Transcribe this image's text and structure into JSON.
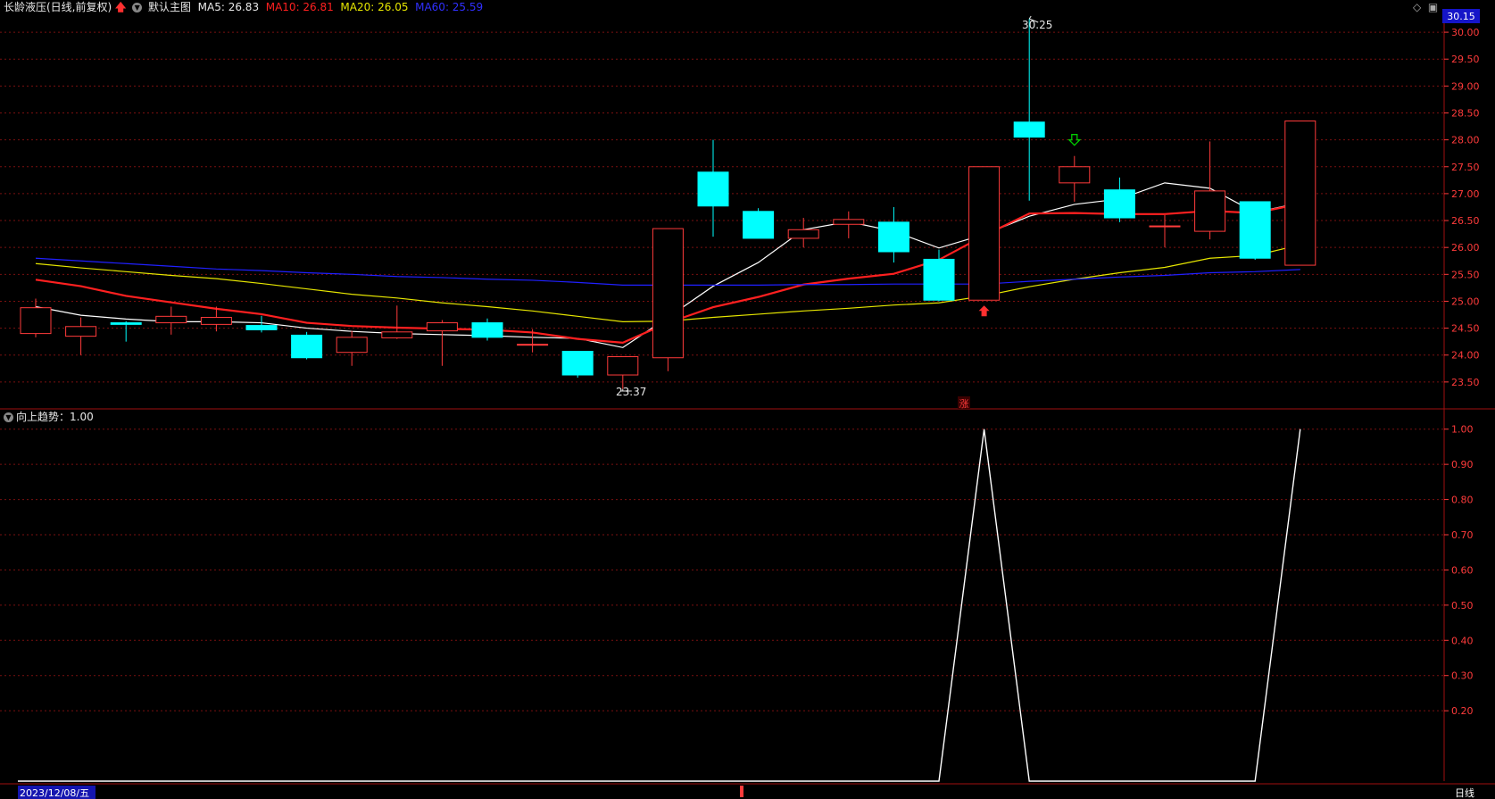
{
  "header": {
    "stock_name": "长龄液压(日线,前复权)",
    "template_label": "默认主图",
    "ma5_label": "MA5: 26.83",
    "ma10_label": "MA10: 26.81",
    "ma20_label": "MA20: 26.05",
    "ma60_label": "MA60: 25.59",
    "current_price": "30.15"
  },
  "subpanel": {
    "label": "向上趋势：1.00"
  },
  "footer": {
    "date_label": "2023/12/08/五",
    "period_label": "日线"
  },
  "annotations": {
    "high_label": "30.25",
    "low_label": "23.37",
    "zhang_marker": "涨"
  },
  "colors": {
    "up": "#ff3b3b",
    "down": "#00ffff",
    "ma5": "#ffffff",
    "ma10": "#ff2020",
    "ma20": "#e6e600",
    "ma60": "#2020ff",
    "grid": "#7a1010",
    "indicator": "#ffffff"
  },
  "chart_data": [
    {
      "type": "candlestick",
      "ylim": [
        23.0,
        30.3
      ],
      "y_ticks": [
        23.5,
        24.0,
        24.5,
        25.0,
        25.5,
        26.0,
        26.5,
        27.0,
        27.5,
        28.0,
        28.5,
        29.0,
        29.5,
        30.0
      ],
      "candles": [
        {
          "o": 24.4,
          "c": 24.88,
          "h": 25.05,
          "l": 24.33
        },
        {
          "o": 24.35,
          "c": 24.53,
          "h": 24.7,
          "l": 24.0
        },
        {
          "o": 24.6,
          "c": 24.57,
          "h": 24.63,
          "l": 24.25
        },
        {
          "o": 24.6,
          "c": 24.72,
          "h": 24.9,
          "l": 24.38
        },
        {
          "o": 24.57,
          "c": 24.7,
          "h": 24.9,
          "l": 24.44
        },
        {
          "o": 24.55,
          "c": 24.47,
          "h": 24.73,
          "l": 24.42
        },
        {
          "o": 24.37,
          "c": 23.95,
          "h": 24.43,
          "l": 23.92
        },
        {
          "o": 24.05,
          "c": 24.33,
          "h": 24.45,
          "l": 23.8
        },
        {
          "o": 24.32,
          "c": 24.43,
          "h": 24.92,
          "l": 24.3
        },
        {
          "o": 24.45,
          "c": 24.6,
          "h": 24.65,
          "l": 23.8
        },
        {
          "o": 24.6,
          "c": 24.33,
          "h": 24.68,
          "l": 24.27
        },
        {
          "o": 24.2,
          "c": 24.2,
          "h": 24.48,
          "l": 24.05
        },
        {
          "o": 24.07,
          "c": 23.63,
          "h": 24.07,
          "l": 23.58
        },
        {
          "o": 23.63,
          "c": 23.97,
          "h": 23.97,
          "l": 23.37
        },
        {
          "o": 23.95,
          "c": 26.35,
          "h": 26.35,
          "l": 23.7
        },
        {
          "o": 27.4,
          "c": 26.77,
          "h": 28.0,
          "l": 26.2
        },
        {
          "o": 26.67,
          "c": 26.17,
          "h": 26.73,
          "l": 26.17
        },
        {
          "o": 26.17,
          "c": 26.33,
          "h": 26.55,
          "l": 26.0
        },
        {
          "o": 26.43,
          "c": 26.52,
          "h": 26.67,
          "l": 26.17
        },
        {
          "o": 26.47,
          "c": 25.92,
          "h": 26.75,
          "l": 25.72
        },
        {
          "o": 25.78,
          "c": 25.02,
          "h": 25.96,
          "l": 25.0
        },
        {
          "o": 25.02,
          "c": 27.5,
          "h": 27.5,
          "l": 25.02
        },
        {
          "o": 28.33,
          "c": 28.05,
          "h": 30.25,
          "l": 26.87
        },
        {
          "o": 27.2,
          "c": 27.5,
          "h": 27.7,
          "l": 26.85
        },
        {
          "o": 27.07,
          "c": 26.55,
          "h": 27.3,
          "l": 26.47
        },
        {
          "o": 26.4,
          "c": 26.4,
          "h": 26.6,
          "l": 26.0
        },
        {
          "o": 26.3,
          "c": 27.05,
          "h": 27.97,
          "l": 26.15
        },
        {
          "o": 26.85,
          "c": 25.8,
          "h": 26.85,
          "l": 25.77
        },
        {
          "o": 25.67,
          "c": 28.35,
          "h": 28.35,
          "l": 25.67
        }
      ],
      "series": [
        {
          "name": "MA5",
          "values": [
            24.9,
            24.74,
            24.67,
            24.62,
            24.62,
            24.6,
            24.5,
            24.44,
            24.4,
            24.38,
            24.36,
            24.33,
            24.31,
            24.14,
            24.7,
            25.28,
            25.72,
            26.33,
            26.48,
            26.3,
            25.99,
            26.24,
            26.58,
            26.8,
            26.9,
            27.2,
            27.1,
            26.65,
            26.83
          ]
        },
        {
          "name": "MA10",
          "values": [
            25.4,
            25.28,
            25.1,
            24.98,
            24.86,
            24.76,
            24.6,
            24.54,
            24.51,
            24.49,
            24.47,
            24.42,
            24.3,
            24.23,
            24.6,
            24.89,
            25.08,
            25.31,
            25.42,
            25.51,
            25.77,
            26.22,
            26.63,
            26.64,
            26.62,
            26.62,
            26.68,
            26.64,
            26.81
          ]
        },
        {
          "name": "MA20",
          "values": [
            25.7,
            25.62,
            25.55,
            25.48,
            25.42,
            25.33,
            25.23,
            25.13,
            25.06,
            24.97,
            24.9,
            24.82,
            24.72,
            24.62,
            24.63,
            24.7,
            24.76,
            24.82,
            24.87,
            24.93,
            24.97,
            25.1,
            25.27,
            25.41,
            25.53,
            25.63,
            25.8,
            25.85,
            26.05
          ]
        },
        {
          "name": "MA60",
          "values": [
            25.8,
            25.75,
            25.7,
            25.65,
            25.6,
            25.57,
            25.53,
            25.5,
            25.46,
            25.44,
            25.41,
            25.39,
            25.35,
            25.3,
            25.3,
            25.3,
            25.3,
            25.31,
            25.31,
            25.32,
            25.32,
            25.32,
            25.37,
            25.41,
            25.45,
            25.48,
            25.53,
            25.55,
            25.59
          ]
        }
      ],
      "markers": {
        "sell_arrow_index": 23,
        "buy_arrow_index": 21,
        "zhang_index": 21,
        "high_index": 22,
        "low_index": 13
      }
    },
    {
      "type": "line",
      "ylim": [
        0,
        1.05
      ],
      "y_ticks": [
        0.2,
        0.3,
        0.4,
        0.5,
        0.6,
        0.7,
        0.8,
        0.9,
        1.0
      ],
      "series": [
        {
          "name": "向上趋势",
          "values": [
            0,
            0,
            0,
            0,
            0,
            0,
            0,
            0,
            0,
            0,
            0,
            0,
            0,
            0,
            0,
            0,
            0,
            0,
            0,
            0,
            0,
            1,
            0,
            0,
            0,
            0,
            0,
            0,
            1
          ]
        }
      ]
    }
  ]
}
